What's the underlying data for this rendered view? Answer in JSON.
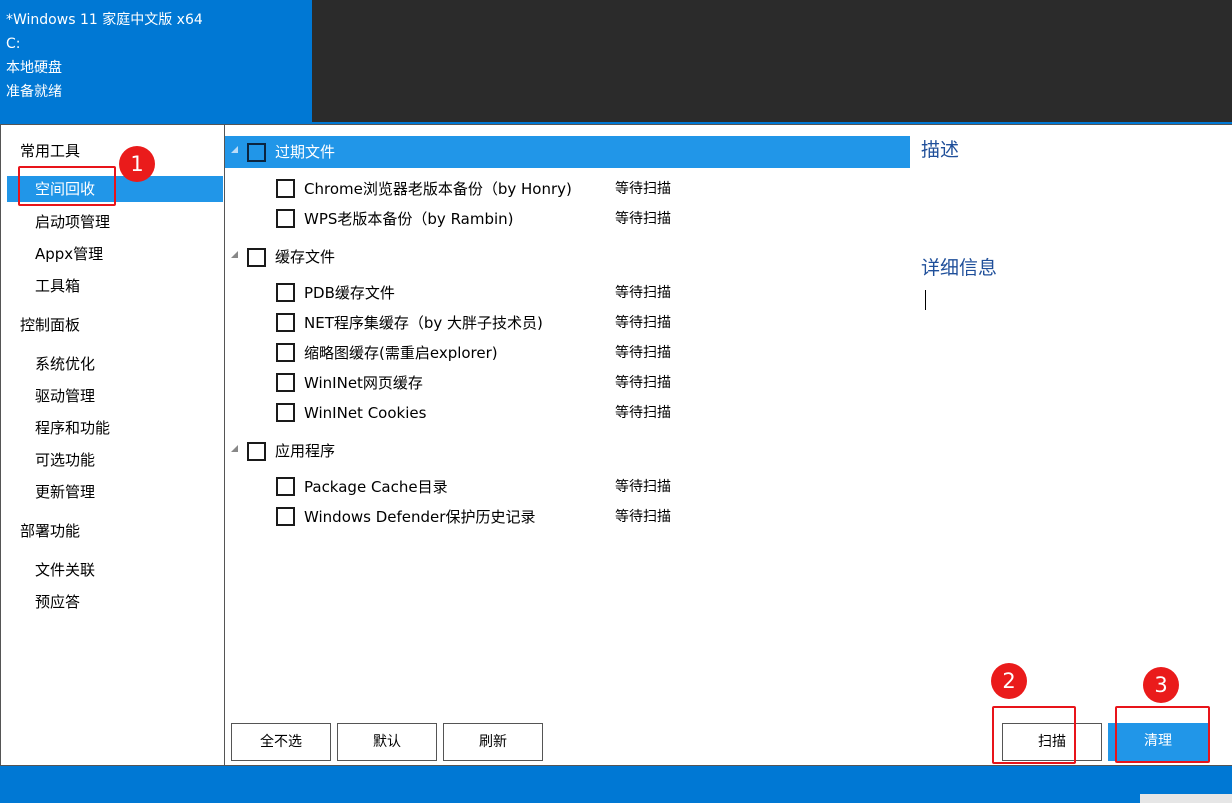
{
  "header": {
    "lines": [
      "*Windows 11 家庭中文版 x64",
      "C:",
      "本地硬盘",
      "准备就绪"
    ]
  },
  "sidebar": {
    "sections": [
      {
        "label": "常用工具",
        "items": [
          "空间回收",
          "启动项管理",
          "Appx管理",
          "工具箱"
        ]
      },
      {
        "label": "控制面板",
        "items": [
          "系统优化",
          "驱动管理",
          "程序和功能",
          "可选功能",
          "更新管理"
        ]
      },
      {
        "label": "部署功能",
        "items": [
          "文件关联",
          "预应答"
        ]
      }
    ],
    "selected": "空间回收"
  },
  "groups": [
    {
      "label": "过期文件",
      "items": [
        {
          "label": "Chrome浏览器老版本备份（by Honry)",
          "status": "等待扫描"
        },
        {
          "label": "WPS老版本备份（by Rambin)",
          "status": "等待扫描"
        }
      ]
    },
    {
      "label": "缓存文件",
      "items": [
        {
          "label": "PDB缓存文件",
          "status": "等待扫描"
        },
        {
          "label": "NET程序集缓存（by 大胖子技术员)",
          "status": "等待扫描"
        },
        {
          "label": "缩略图缓存(需重启explorer)",
          "status": "等待扫描"
        },
        {
          "label": "WinINet网页缓存",
          "status": "等待扫描"
        },
        {
          "label": "WinINet Cookies",
          "status": "等待扫描"
        }
      ]
    },
    {
      "label": "应用程序",
      "items": [
        {
          "label": "Package Cache目录",
          "status": "等待扫描"
        },
        {
          "label": "Windows Defender保护历史记录",
          "status": "等待扫描"
        }
      ]
    }
  ],
  "buttons": {
    "deselect_all": "全不选",
    "default": "默认",
    "refresh": "刷新",
    "scan": "扫描",
    "clean": "清理"
  },
  "details": {
    "description_heading": "描述",
    "info_heading": "详细信息"
  },
  "markers": [
    "1",
    "2",
    "3"
  ],
  "colors": {
    "accent": "#2196e8",
    "title_bar": "#0078d4",
    "annotation_red": "#e8141a"
  }
}
